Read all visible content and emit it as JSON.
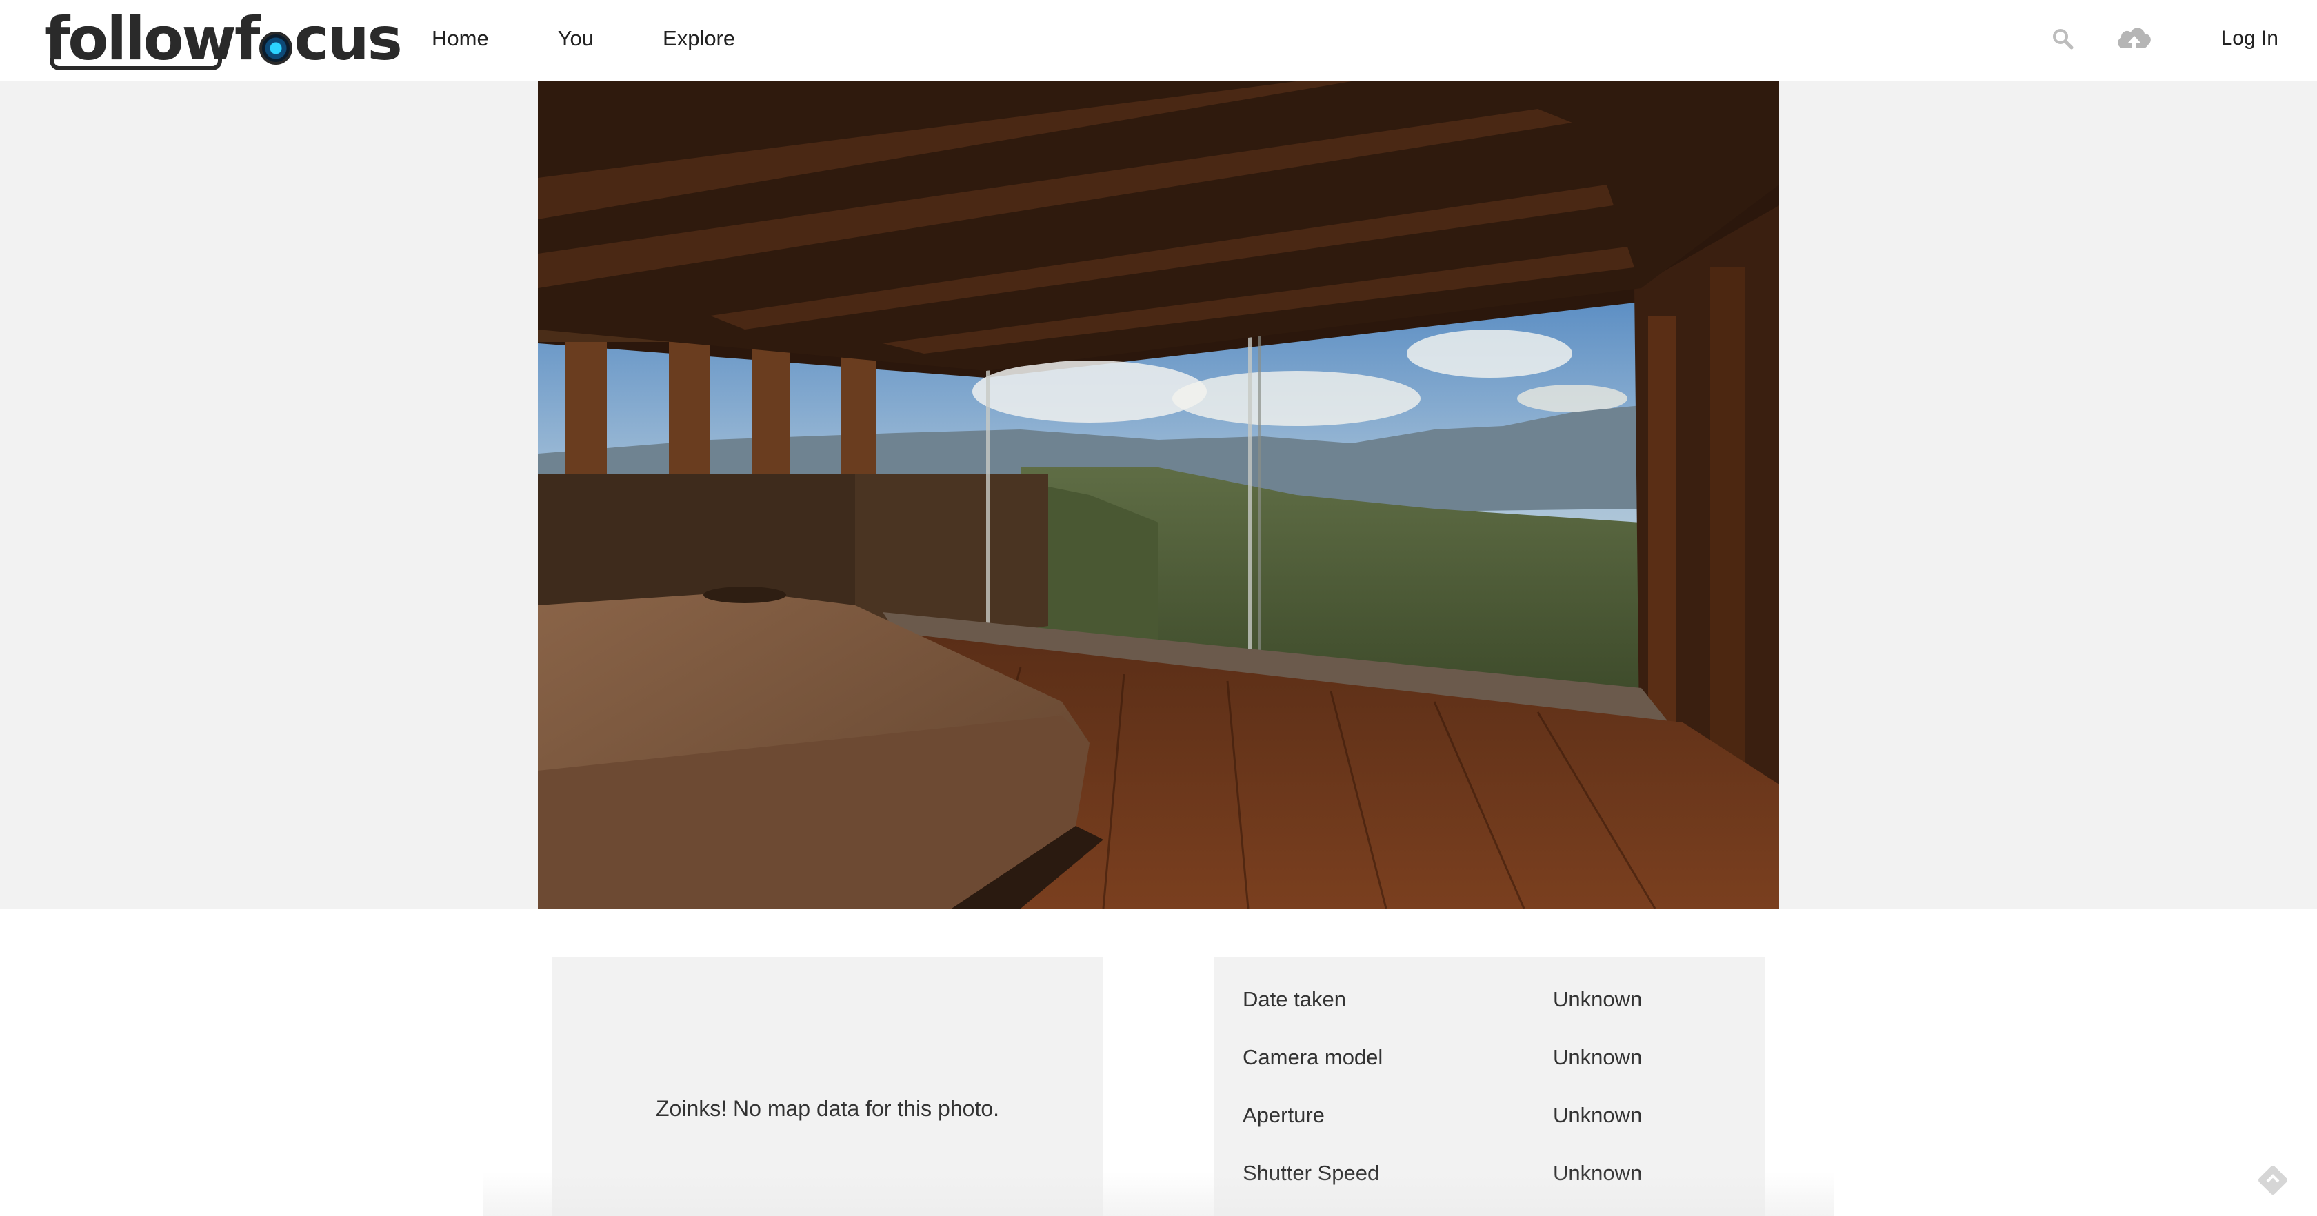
{
  "header": {
    "logo": "followfocus",
    "nav": [
      {
        "label": "Home"
      },
      {
        "label": "You"
      },
      {
        "label": "Explore"
      }
    ],
    "search_icon": "search-icon",
    "upload_icon": "cloud-upload-icon",
    "login_label": "Log In"
  },
  "photo": {
    "subject": "bedroom-with-mountain-view",
    "icon": "photo-image"
  },
  "map": {
    "message": "Zoinks! No map data for this photo."
  },
  "exif": {
    "rows": [
      {
        "label": "Date taken",
        "value": "Unknown"
      },
      {
        "label": "Camera model",
        "value": "Unknown"
      },
      {
        "label": "Aperture",
        "value": "Unknown"
      },
      {
        "label": "Shutter Speed",
        "value": "Unknown"
      }
    ]
  },
  "colors": {
    "accent": "#2cd3ff",
    "panel_bg": "#f2f2f2",
    "text": "#222222",
    "icon_gray": "#b5b5b5"
  },
  "feedback_icon": "feedback-tag-icon"
}
